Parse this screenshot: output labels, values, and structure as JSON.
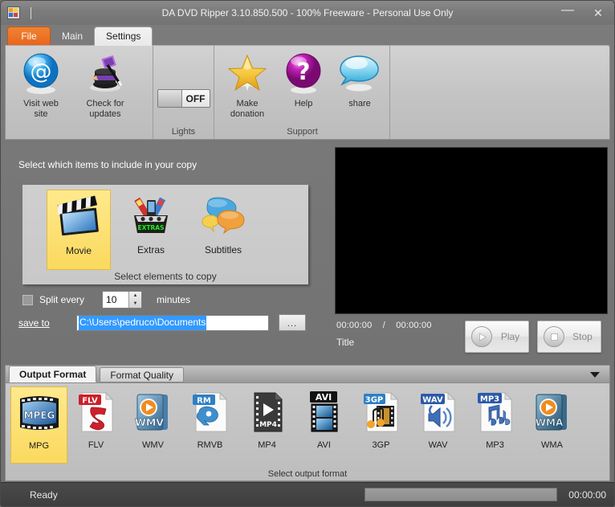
{
  "window": {
    "title": "DA DVD Ripper 3.10.850.500 - 100% Freeware - Personal Use Only",
    "app_icon": "app-logo-icon",
    "minimize_label": "—",
    "close_label": "✕"
  },
  "tabs": [
    {
      "id": "file",
      "label": "File",
      "state": "file"
    },
    {
      "id": "main",
      "label": "Main",
      "state": "normal"
    },
    {
      "id": "settings",
      "label": "Settings",
      "state": "active"
    }
  ],
  "ribbon": {
    "groups": [
      {
        "id": "website-updates",
        "label": "",
        "items": [
          {
            "id": "visit-web-site",
            "label": "Visit web\nsite",
            "icon": "at-sign-icon"
          },
          {
            "id": "check-for-updates",
            "label": "Check for\nupdates",
            "icon": "magic-hat-icon"
          }
        ]
      },
      {
        "id": "lights",
        "label": "Lights",
        "items": [
          {
            "id": "lights-toggle",
            "label": "OFF",
            "icon": "toggle-switch-icon"
          }
        ]
      },
      {
        "id": "support",
        "label": "Support",
        "items": [
          {
            "id": "make-donation",
            "label": "Make\ndonation",
            "icon": "star-icon"
          },
          {
            "id": "help",
            "label": "Help",
            "icon": "question-mark-icon"
          },
          {
            "id": "share",
            "label": "share",
            "icon": "speech-bubble-icon"
          }
        ]
      }
    ]
  },
  "main": {
    "hint": "Select which items to include in your copy",
    "select_footer": "Select elements to copy",
    "copy_items": [
      {
        "id": "movie",
        "label": "Movie",
        "icon": "clapperboard-icon",
        "selected": true
      },
      {
        "id": "extras",
        "label": "Extras",
        "icon": "extras-icon",
        "selected": false
      },
      {
        "id": "subtitles",
        "label": "Subtitles",
        "icon": "subtitles-bubbles-icon",
        "selected": false
      }
    ],
    "split": {
      "checkbox_label": "Split every",
      "value": "10",
      "unit_label": "minutes",
      "checked": false
    },
    "save": {
      "label": "save to",
      "path": "C:\\Users\\pedruco\\Documents",
      "browse_label": "..."
    }
  },
  "preview": {
    "current_time": "00:00:00",
    "separator": "/",
    "total_time": "00:00:00",
    "title_label": "Title",
    "play_label": "Play",
    "stop_label": "Stop"
  },
  "output": {
    "tabs": [
      {
        "id": "output-format",
        "label": "Output Format",
        "active": true
      },
      {
        "id": "format-quality",
        "label": "Format Quality",
        "active": false
      }
    ],
    "footer": "Select output format",
    "formats": [
      {
        "id": "mpg",
        "label": "MPG",
        "icon": "mpeg-film-icon",
        "selected": true
      },
      {
        "id": "flv",
        "label": "FLV",
        "icon": "flv-flash-icon",
        "selected": false
      },
      {
        "id": "wmv",
        "label": "WMV",
        "icon": "wmv-icon",
        "selected": false
      },
      {
        "id": "rmvb",
        "label": "RMVB",
        "icon": "realmedia-icon",
        "selected": false
      },
      {
        "id": "mp4",
        "label": "MP4",
        "icon": "mp4-film-icon",
        "selected": false
      },
      {
        "id": "avi",
        "label": "AVI",
        "icon": "avi-filmstrip-icon",
        "selected": false
      },
      {
        "id": "3gp",
        "label": "3GP",
        "icon": "3gp-icon",
        "selected": false
      },
      {
        "id": "wav",
        "label": "WAV",
        "icon": "wav-speaker-icon",
        "selected": false
      },
      {
        "id": "mp3",
        "label": "MP3",
        "icon": "mp3-notes-icon",
        "selected": false
      },
      {
        "id": "wma",
        "label": "WMA",
        "icon": "wma-icon",
        "selected": false
      }
    ]
  },
  "statusbar": {
    "status": "Ready",
    "elapsed": "00:00:00"
  },
  "colors": {
    "accent_orange": "#e8661c",
    "selection_yellow": "#fbd95e",
    "text_highlight_blue": "#3399ff",
    "window_gray": "#737373"
  }
}
